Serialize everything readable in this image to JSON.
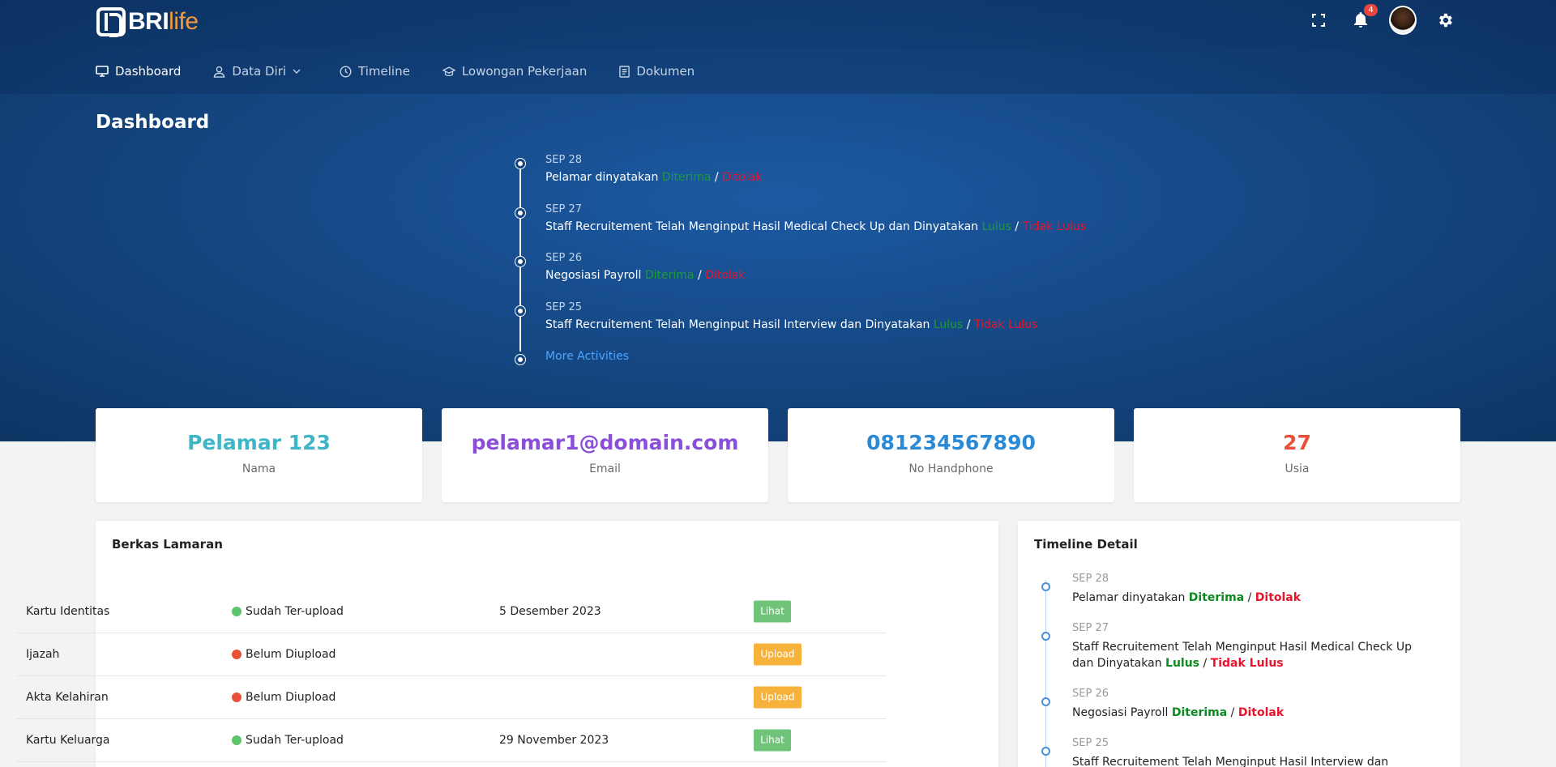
{
  "brand": {
    "name_a": "BRI",
    "name_b": "life"
  },
  "topbar": {
    "notification_count": "4",
    "icons": [
      "fullscreen-icon",
      "bell-icon",
      "avatar",
      "gear-icon"
    ]
  },
  "nav": {
    "items": [
      {
        "label": "Dashboard",
        "icon": "monitor-icon",
        "active": true
      },
      {
        "label": "Data Diri",
        "icon": "user-icon",
        "has_dropdown": true
      },
      {
        "label": "Timeline",
        "icon": "clock-icon"
      },
      {
        "label": "Lowongan Pekerjaan",
        "icon": "graduation-cap-icon"
      },
      {
        "label": "Dokumen",
        "icon": "document-icon"
      }
    ]
  },
  "page": {
    "title": "Dashboard"
  },
  "hero_timeline": {
    "items": [
      {
        "date": "SEP 28",
        "text": "Pelamar dinyatakan ",
        "ok": "Diterima",
        "sep": " / ",
        "no": "Ditolak"
      },
      {
        "date": "SEP 27",
        "text": "Staff Recruitement Telah Menginput Hasil Medical Check Up dan Dinyatakan ",
        "ok": "Lulus",
        "sep": " / ",
        "no": "Tidak Lulus"
      },
      {
        "date": "SEP 26",
        "text": "Negosiasi Payroll ",
        "ok": "Diterima",
        "sep": " / ",
        "no": "Ditolak"
      },
      {
        "date": "SEP 25",
        "text": "Staff Recruitement Telah Menginput Hasil Interview dan Dinyatakan ",
        "ok": "Lulus",
        "sep": " / ",
        "no": "Tidak Lulus"
      }
    ],
    "more_label": "More Activities"
  },
  "cards": [
    {
      "value": "Pelamar 123",
      "label": "Nama",
      "color": "#3fb6c6"
    },
    {
      "value": "pelamar1@domain.com",
      "label": "Email",
      "color": "#8a4fd8"
    },
    {
      "value": "081234567890",
      "label": "No Handphone",
      "color": "#2a8ad6"
    },
    {
      "value": "27",
      "label": "Usia",
      "color": "#e8503a"
    }
  ],
  "berkas": {
    "title": "Berkas Lamaran",
    "rows": [
      {
        "doc": "Kartu Identitas",
        "status": "Sudah Ter-upload",
        "status_color": "#5ec46c",
        "date": "5 Desember 2023",
        "action": "Lihat",
        "action_color": "#6fc47a"
      },
      {
        "doc": "Ijazah",
        "status": "Belum Diupload",
        "status_color": "#e8503a",
        "date": "",
        "action": "Upload",
        "action_color": "#f7b23b"
      },
      {
        "doc": "Akta Kelahiran",
        "status": "Belum Diupload",
        "status_color": "#e8503a",
        "date": "",
        "action": "Upload",
        "action_color": "#f7b23b"
      },
      {
        "doc": "Kartu Keluarga",
        "status": "Sudah Ter-upload",
        "status_color": "#5ec46c",
        "date": "29 November 2023",
        "action": "Lihat",
        "action_color": "#6fc47a"
      }
    ]
  },
  "timeline_detail": {
    "title": "Timeline Detail",
    "items": [
      {
        "date": "SEP 28",
        "text": "Pelamar dinyatakan ",
        "ok": "Diterima",
        "sep": " / ",
        "no": "Ditolak"
      },
      {
        "date": "SEP 27",
        "text": "Staff Recruitement Telah Menginput Hasil Medical Check Up dan Dinyatakan ",
        "ok": "Lulus",
        "sep": " / ",
        "no": "Tidak Lulus"
      },
      {
        "date": "SEP 26",
        "text": "Negosiasi Payroll ",
        "ok": "Diterima",
        "sep": " / ",
        "no": "Ditolak"
      },
      {
        "date": "SEP 25",
        "text": "Staff Recruitement Telah Menginput Hasil Interview dan Dinyatakan",
        "ok": "",
        "sep": "",
        "no": ""
      }
    ]
  }
}
